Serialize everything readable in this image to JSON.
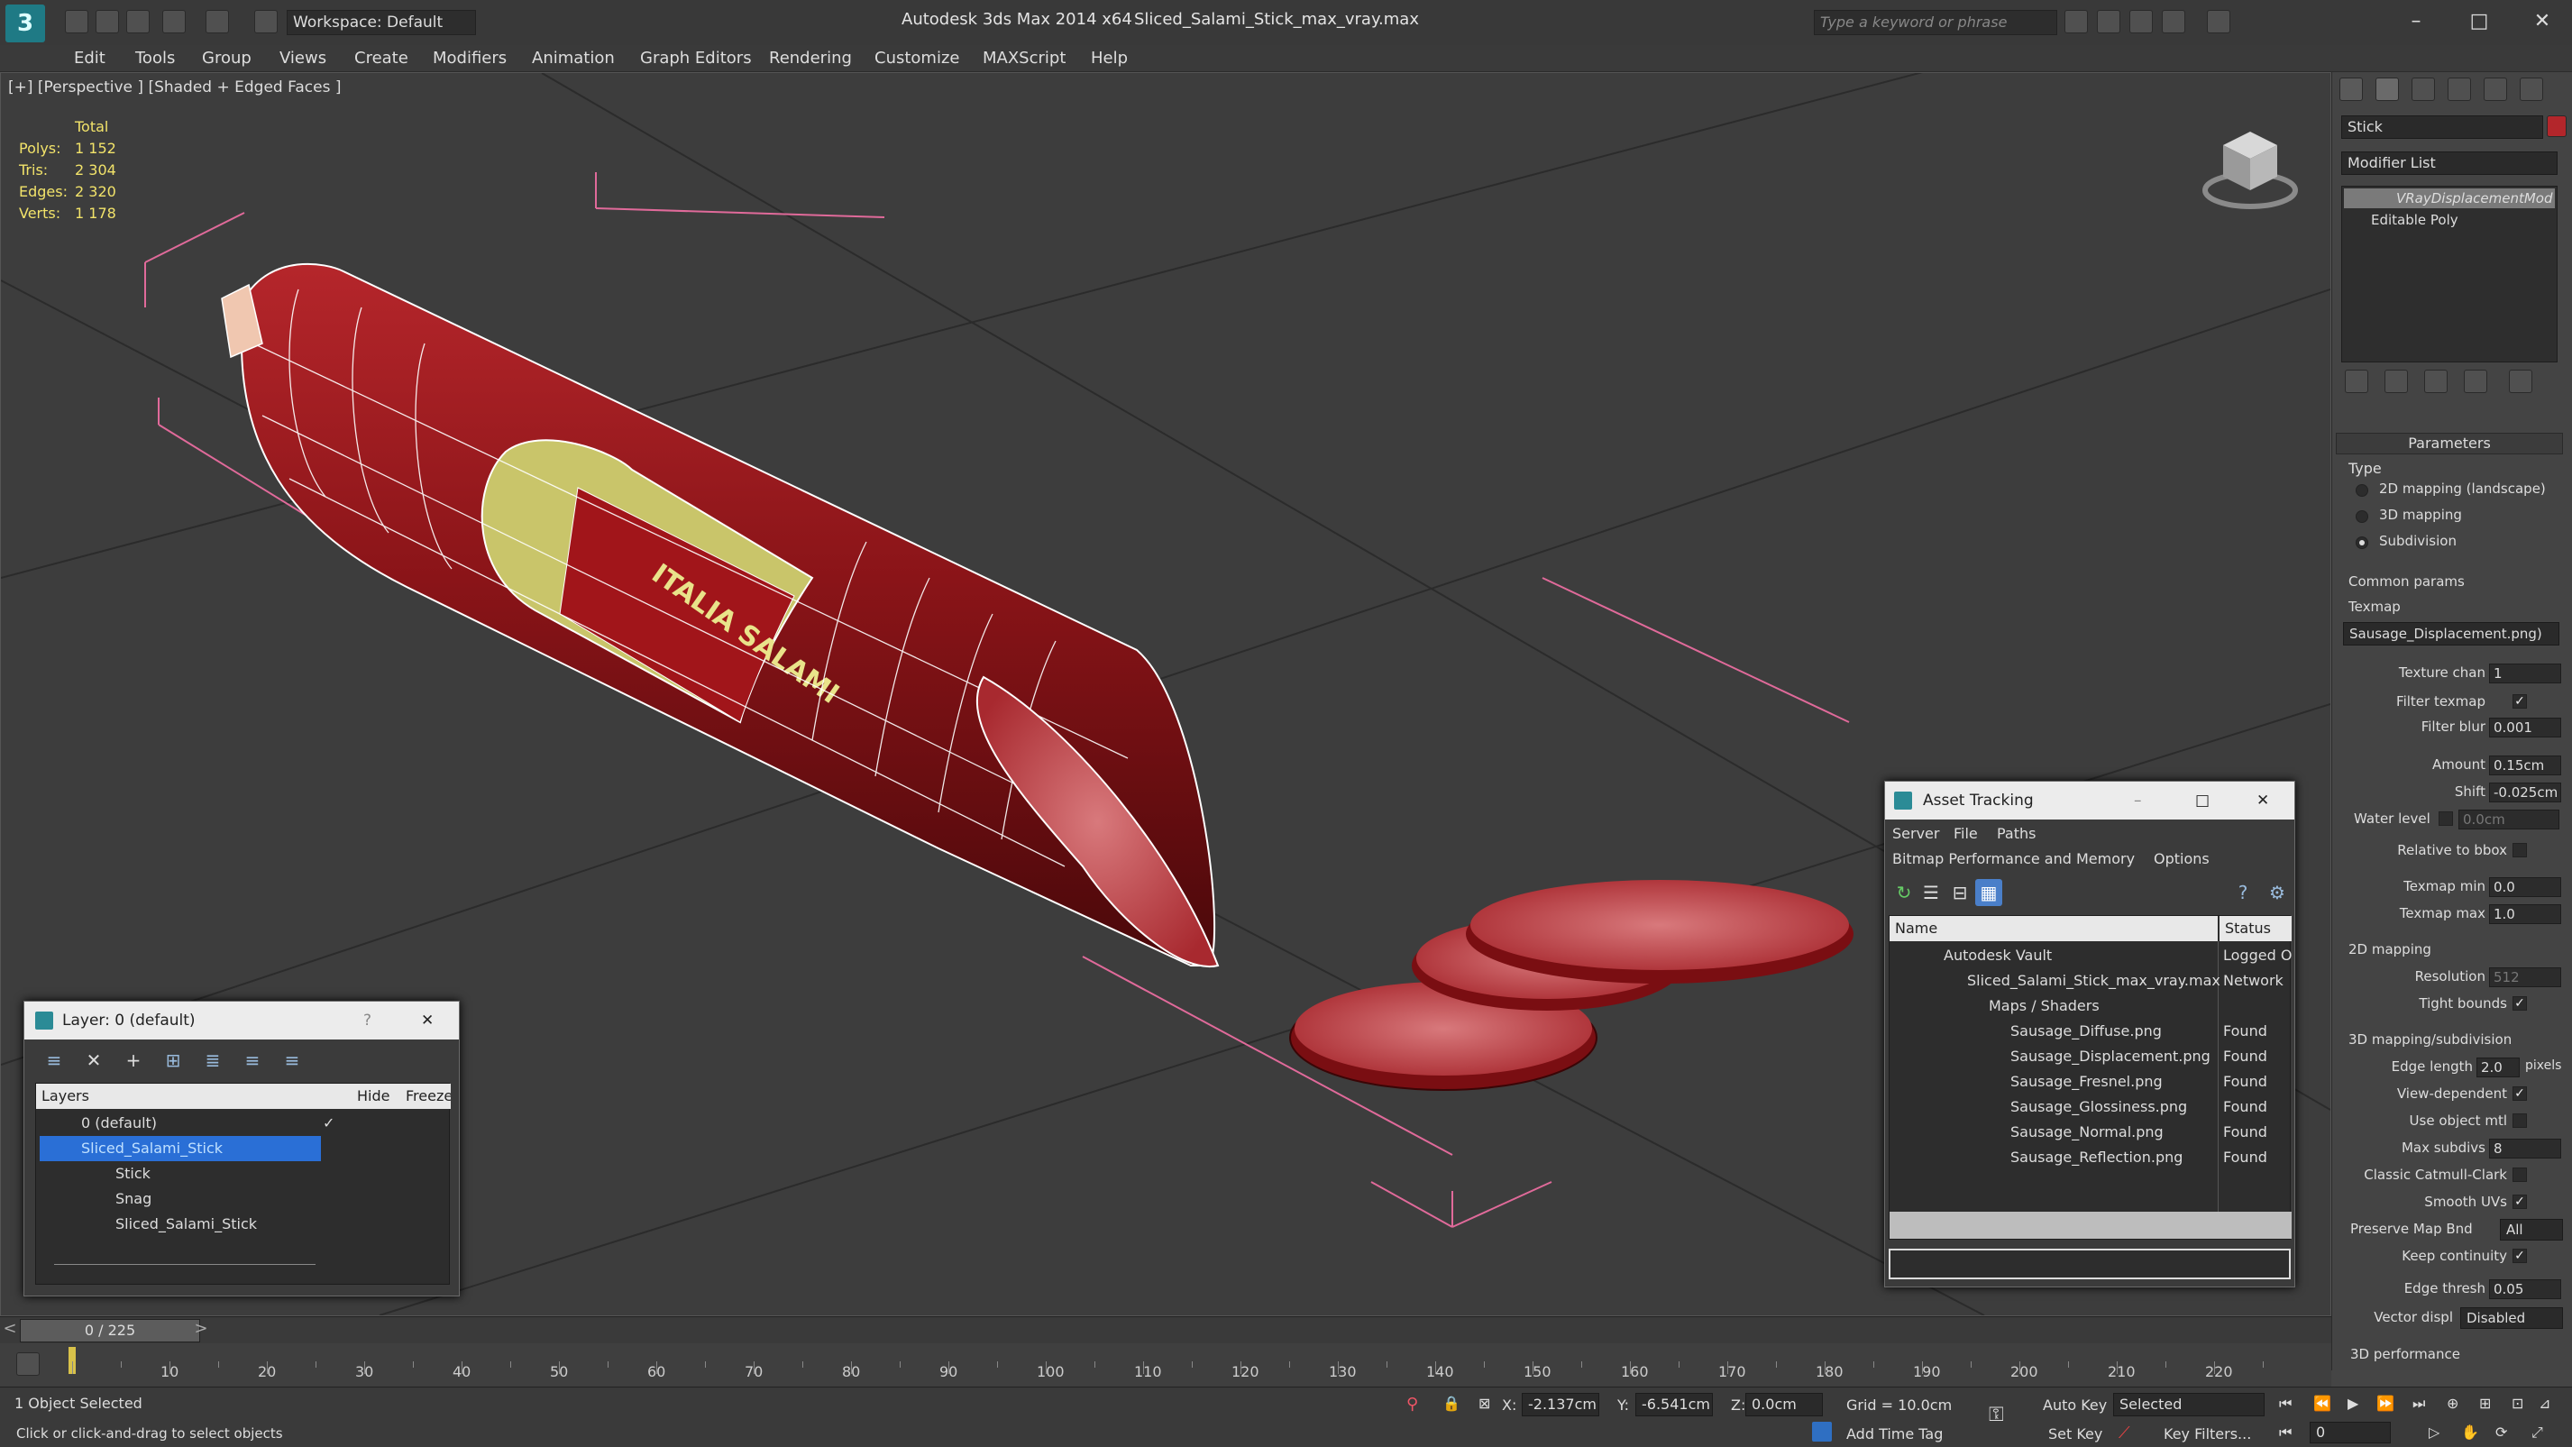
{
  "title_bar": {
    "app_title": "Autodesk 3ds Max  2014 x64",
    "file_name": "Sliced_Salami_Stick_max_vray.max",
    "workspace": "Workspace: Default",
    "search_placeholder": "Type a keyword or phrase"
  },
  "menu": [
    "Edit",
    "Tools",
    "Group",
    "Views",
    "Create",
    "Modifiers",
    "Animation",
    "Graph Editors",
    "Rendering",
    "Customize",
    "MAXScript",
    "Help"
  ],
  "viewport": {
    "label": "[+] [Perspective ] [Shaded + Edged Faces ]",
    "stats_header": "Total",
    "stats": [
      {
        "label": "Polys:",
        "value": "1 152"
      },
      {
        "label": "Tris:",
        "value": "2 304"
      },
      {
        "label": "Edges:",
        "value": "2 320"
      },
      {
        "label": "Verts:",
        "value": "1 178"
      }
    ],
    "label_text": "ITALIA SALAMI"
  },
  "command_panel": {
    "object_name": "Stick",
    "modifier_list": "Modifier List",
    "stack": [
      "VRayDisplacementMod",
      "Editable Poly"
    ],
    "rollout": "Parameters",
    "type_label": "Type",
    "types": [
      {
        "label": "2D mapping (landscape)",
        "selected": false
      },
      {
        "label": "3D mapping",
        "selected": false
      },
      {
        "label": "Subdivision",
        "selected": true
      }
    ],
    "common_params": "Common params",
    "texmap_label": "Texmap",
    "texmap_value": "Sausage_Displacement.png)",
    "texture_chan": {
      "label": "Texture chan",
      "value": "1"
    },
    "filter_texmap": {
      "label": "Filter texmap",
      "checked": true
    },
    "filter_blur": {
      "label": "Filter blur",
      "value": "0.001"
    },
    "amount": {
      "label": "Amount",
      "value": "0.15cm"
    },
    "shift": {
      "label": "Shift",
      "value": "-0.025cm"
    },
    "water_level": {
      "label": "Water level",
      "value": "0.0cm"
    },
    "relative_bbox": "Relative to bbox",
    "texmap_min": {
      "label": "Texmap min",
      "value": "0.0"
    },
    "texmap_max": {
      "label": "Texmap max",
      "value": "1.0"
    },
    "mapping_2d": "2D mapping",
    "resolution": {
      "label": "Resolution",
      "value": "512"
    },
    "tight_bounds": "Tight bounds",
    "mapping_3d": "3D mapping/subdivision",
    "edge_length": {
      "label": "Edge length",
      "value": "2.0",
      "unit": "pixels"
    },
    "view_dependent": "View-dependent",
    "use_object_mtl": "Use object mtl",
    "max_subdivs": {
      "label": "Max subdivs",
      "value": "8"
    },
    "catmull": "Classic Catmull-Clark",
    "smooth_uvs": "Smooth UVs",
    "preserve_map": {
      "label": "Preserve Map Bnd",
      "value": "All"
    },
    "keep_continuity": "Keep continuity",
    "edge_thresh": {
      "label": "Edge thresh",
      "value": "0.05"
    },
    "vector_displ": {
      "label": "Vector displ",
      "value": "Disabled"
    },
    "performance": "3D performance"
  },
  "layer_dialog": {
    "title": "Layer: 0 (default)",
    "help": "?",
    "columns": [
      "Layers",
      "Hide",
      "Freeze"
    ],
    "rows": [
      {
        "name": "0 (default)",
        "indent": 0,
        "selected": false
      },
      {
        "name": "Sliced_Salami_Stick",
        "indent": 0,
        "selected": true
      },
      {
        "name": "Stick",
        "indent": 1,
        "selected": false
      },
      {
        "name": "Snag",
        "indent": 1,
        "selected": false
      },
      {
        "name": "Sliced_Salami_Stick",
        "indent": 1,
        "selected": false
      }
    ]
  },
  "asset_dialog": {
    "title": "Asset Tracking",
    "menus": [
      "Server",
      "File",
      "Paths"
    ],
    "menus2": [
      "Bitmap Performance and Memory",
      "Options"
    ],
    "columns": [
      "Name",
      "Status"
    ],
    "rows": [
      {
        "name": "Autodesk Vault",
        "status": "Logged O",
        "indent": 0
      },
      {
        "name": "Sliced_Salami_Stick_max_vray.max",
        "status": "Network",
        "indent": 1
      },
      {
        "name": "Maps / Shaders",
        "status": "",
        "indent": 2
      },
      {
        "name": "Sausage_Diffuse.png",
        "status": "Found",
        "indent": 3
      },
      {
        "name": "Sausage_Displacement.png",
        "status": "Found",
        "indent": 3
      },
      {
        "name": "Sausage_Fresnel.png",
        "status": "Found",
        "indent": 3
      },
      {
        "name": "Sausage_Glossiness.png",
        "status": "Found",
        "indent": 3
      },
      {
        "name": "Sausage_Normal.png",
        "status": "Found",
        "indent": 3
      },
      {
        "name": "Sausage_Reflection.png",
        "status": "Found",
        "indent": 3
      }
    ]
  },
  "timeline": {
    "frame": "0 / 225",
    "ticks": [
      "10",
      "20",
      "30",
      "40",
      "50",
      "60",
      "70",
      "80",
      "90",
      "100",
      "110",
      "120",
      "130",
      "140",
      "150",
      "160",
      "170",
      "180",
      "190",
      "200",
      "210",
      "220"
    ]
  },
  "status": {
    "selected": "1 Object Selected",
    "hint": "Click or click-and-drag to select objects",
    "x": "-2.137cm",
    "y": "-6.541cm",
    "z": "0.0cm",
    "grid": "Grid = 10.0cm",
    "auto_key": "Auto Key",
    "set_key": "Set Key",
    "selected_mode": "Selected",
    "key_filters": "Key Filters...",
    "add_time_tag": "Add Time Tag",
    "frame_field": "0"
  }
}
